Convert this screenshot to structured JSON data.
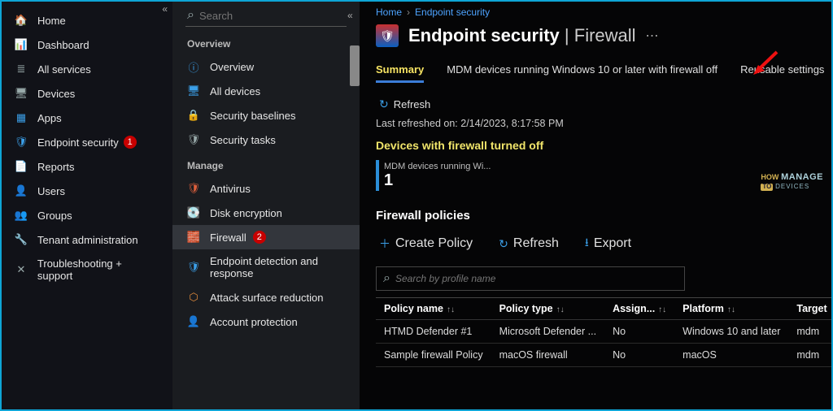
{
  "leftnav": {
    "items": [
      {
        "label": "Home",
        "icon": "🏠",
        "cls": "c-blue"
      },
      {
        "label": "Dashboard",
        "icon": "📊",
        "cls": "c-teal"
      },
      {
        "label": "All services",
        "icon": "≣",
        "cls": "c-gray"
      },
      {
        "label": "Devices",
        "icon": "🖥",
        "cls": "c-gray"
      },
      {
        "label": "Apps",
        "icon": "▦",
        "cls": "c-blue"
      },
      {
        "label": "Endpoint security",
        "icon": "🛡",
        "cls": "c-blue",
        "badge": "1"
      },
      {
        "label": "Reports",
        "icon": "📄",
        "cls": "c-blue"
      },
      {
        "label": "Users",
        "icon": "👤",
        "cls": "c-blue"
      },
      {
        "label": "Groups",
        "icon": "👥",
        "cls": "c-blue"
      },
      {
        "label": "Tenant administration",
        "icon": "🔧",
        "cls": "c-blue"
      },
      {
        "label": "Troubleshooting + support",
        "icon": "✕",
        "cls": "c-gray"
      }
    ]
  },
  "subpanel": {
    "search_placeholder": "Search",
    "group_overview": "Overview",
    "group_manage": "Manage",
    "overview_items": [
      {
        "label": "Overview",
        "icon": "ⓘ",
        "cls": "c-blue"
      },
      {
        "label": "All devices",
        "icon": "🖥",
        "cls": "c-blue"
      },
      {
        "label": "Security baselines",
        "icon": "🔒",
        "cls": "c-gray"
      },
      {
        "label": "Security tasks",
        "icon": "🛡",
        "cls": "c-gray"
      }
    ],
    "manage_items": [
      {
        "label": "Antivirus",
        "icon": "🛡",
        "cls": "c-red"
      },
      {
        "label": "Disk encryption",
        "icon": "💽",
        "cls": "c-blue"
      },
      {
        "label": "Firewall",
        "icon": "🧱",
        "cls": "c-orange",
        "active": true,
        "badge": "2"
      },
      {
        "label": "Endpoint detection and response",
        "icon": "🛡",
        "cls": "c-blue"
      },
      {
        "label": "Attack surface reduction",
        "icon": "⬡",
        "cls": "c-orange"
      },
      {
        "label": "Account protection",
        "icon": "👤",
        "cls": "c-gray"
      }
    ]
  },
  "breadcrumb": {
    "items": [
      "Home",
      "Endpoint security"
    ]
  },
  "header": {
    "title_strong": "Endpoint security",
    "title_sep": " | ",
    "title_thin": "Firewall"
  },
  "tabs": {
    "items": [
      {
        "label": "Summary",
        "active": true
      },
      {
        "label": "MDM devices running Windows 10 or later with firewall off"
      },
      {
        "label": "Reusable settings"
      }
    ]
  },
  "refresh": {
    "label": "Refresh",
    "timestamp_prefix": "Last refreshed on:",
    "timestamp": "2/14/2023, 8:17:58 PM"
  },
  "stat": {
    "heading": "Devices with firewall turned off",
    "label": "MDM devices running Wi...",
    "value": "1"
  },
  "policies": {
    "heading": "Firewall policies",
    "cmds": {
      "create": "Create Policy",
      "refresh": "Refresh",
      "export": "Export"
    },
    "search_placeholder": "Search by profile name",
    "columns": [
      "Policy name",
      "Policy type",
      "Assign...",
      "Platform",
      "Target"
    ],
    "rows": [
      {
        "name": "HTMD Defender #1",
        "type": "Microsoft Defender ...",
        "assign": "No",
        "platform": "Windows 10 and later",
        "target": "mdm"
      },
      {
        "name": "Sample firewall Policy",
        "type": "macOS firewall",
        "assign": "No",
        "platform": "macOS",
        "target": "mdm"
      }
    ]
  },
  "watermark": {
    "l1": "HOW",
    "l2": "TO",
    "l3": "MANAGE",
    "l4": "DEVICES"
  }
}
